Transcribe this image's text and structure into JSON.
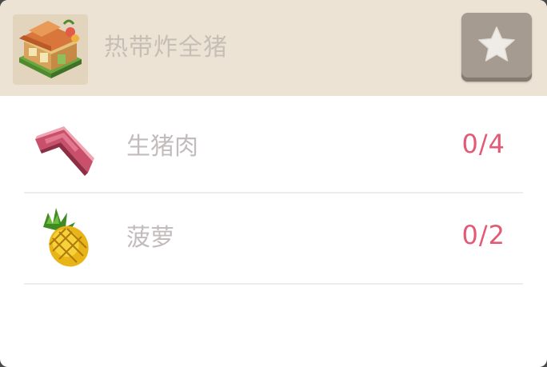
{
  "header": {
    "title": "热带炸全猪",
    "building_icon": "tropical-restaurant-building-icon",
    "favorite_icon": "star-icon"
  },
  "ingredients": [
    {
      "icon": "raw-pork-icon",
      "name": "生猪肉",
      "count": "0/4"
    },
    {
      "icon": "pineapple-icon",
      "name": "菠萝",
      "count": "0/2"
    }
  ],
  "colors": {
    "header_bg": "#ede3d5",
    "title_text": "#c7bfb6",
    "name_text": "#c2bcbc",
    "count_text": "#e25a76",
    "favorite_button_bg": "#a69b90",
    "divider": "#ececec"
  }
}
